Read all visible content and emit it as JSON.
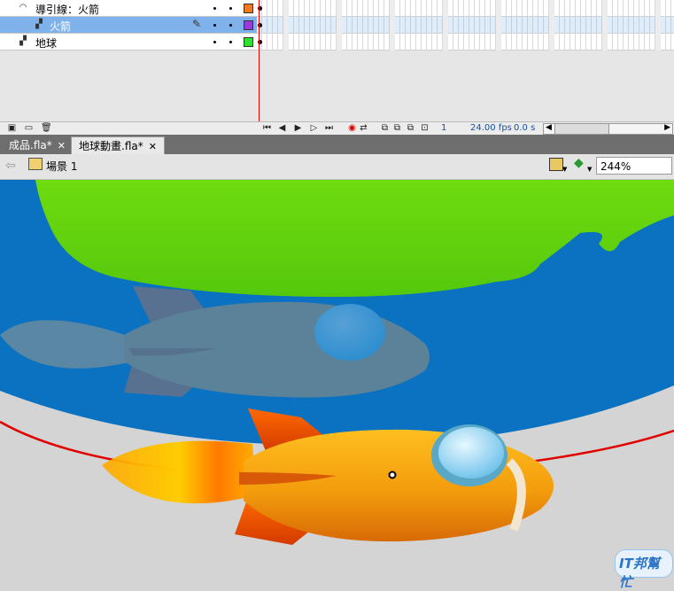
{
  "layers": [
    {
      "name": "導引線：火箭",
      "type": "guide",
      "color": "#f07820",
      "selected": false
    },
    {
      "name": "火箭",
      "type": "layer",
      "color": "#9a3ad8",
      "selected": true
    },
    {
      "name": "地球",
      "type": "layer",
      "color": "#30e030",
      "selected": false
    }
  ],
  "timeline_status": {
    "current_frame": "1",
    "fps": "24.00 fps",
    "elapsed": "0.0 s"
  },
  "tabs": [
    {
      "label": "成品.fla*",
      "active": false
    },
    {
      "label": "地球動畫.fla*",
      "active": true
    }
  ],
  "editbar": {
    "scene": "場景 1",
    "zoom": "244%"
  },
  "stage": {
    "watermark": "IT邦幫忙",
    "colors": {
      "earth_land": "#5fd012",
      "earth_ocean": "#0a72c0",
      "guide_path": "#e00000",
      "rocket_body": "#f3a010"
    }
  }
}
